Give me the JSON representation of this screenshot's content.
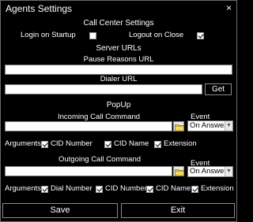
{
  "window": {
    "title": "Agents Settings",
    "close": "×"
  },
  "call_center": {
    "heading": "Call Center Settings",
    "login_label": "Login on Startup",
    "login_checked": false,
    "logout_label": "Logout on Close",
    "logout_checked": true
  },
  "server_urls": {
    "heading": "Server URLs",
    "pause_label": "Pause Reasons URL",
    "pause_value": "",
    "dialer_label": "Dialer URL",
    "dialer_value": "",
    "get_label": "Get"
  },
  "popup": {
    "heading": "PopUp",
    "incoming": {
      "label": "Incoming Call Command",
      "value": "",
      "event_label": "Event",
      "event_value": "On Answer",
      "arguments_label": "Arguments",
      "args": [
        {
          "label": "CID Number",
          "checked": true
        },
        {
          "label": "CID Name",
          "checked": true
        },
        {
          "label": "Extension",
          "checked": true
        }
      ]
    },
    "outgoing": {
      "label": "Outgoing Call Command",
      "value": "",
      "event_label": "Event",
      "event_value": "On Answer",
      "arguments_label": "Arguments",
      "args": [
        {
          "label": "Dial Number",
          "checked": true
        },
        {
          "label": "CID Number",
          "checked": true
        },
        {
          "label": "CID Name",
          "checked": true
        },
        {
          "label": "Extension",
          "checked": true
        }
      ]
    }
  },
  "footer": {
    "save_label": "Save",
    "exit_label": "Exit"
  }
}
